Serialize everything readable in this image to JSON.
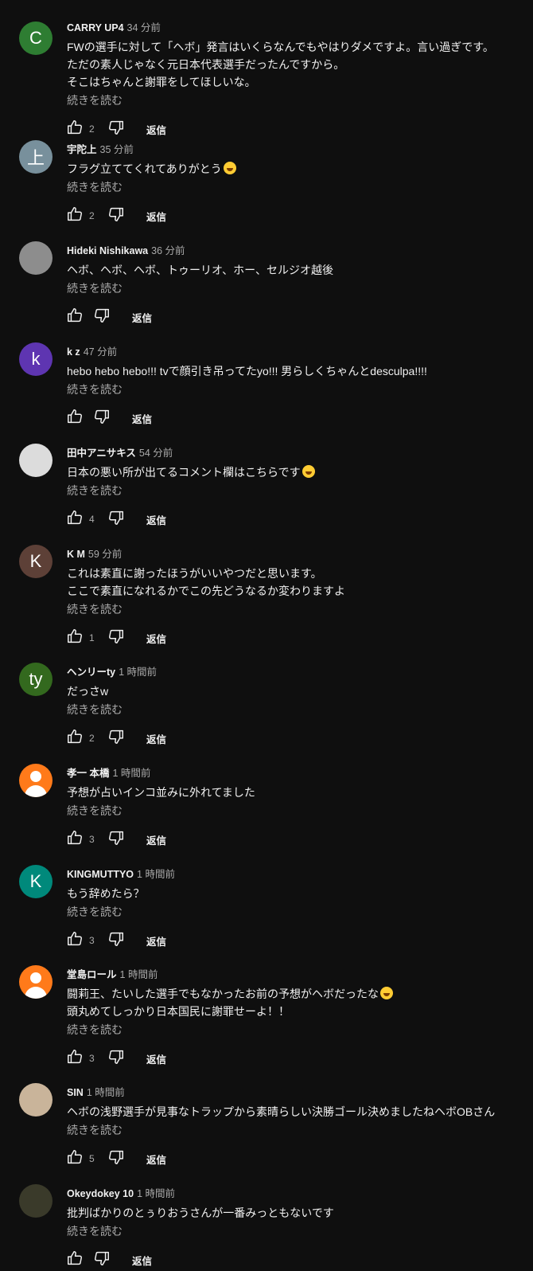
{
  "reply_label": "返信",
  "read_more_label": "続きを読む",
  "comments": [
    {
      "initial": "C",
      "avatar_color": "#2e7d32",
      "author": "CARRY UP4",
      "time": "34 分前",
      "lines": [
        "FWの選手に対して「ヘボ」発言はいくらなんでもやはりダメですよ。言い過ぎです。",
        "ただの素人じゃなく元日本代表選手だったんですから。",
        "そこはちゃんと謝罪をしてほしいな。"
      ],
      "likes": "2"
    },
    {
      "initial": "上",
      "avatar_color": "#78909c",
      "author": "宇陀上",
      "time": "35 分前",
      "lines": [
        "フラグ立ててくれてありがとう"
      ],
      "emoji_line": 0,
      "likes": "2"
    },
    {
      "initial": "",
      "avatar_color": "#8d8d8d",
      "author": "Hideki Nishikawa",
      "time": "36 分前",
      "lines": [
        "ヘボ、ヘボ、ヘボ、トゥーリオ、ホー、セルジオ越後"
      ],
      "likes": ""
    },
    {
      "initial": "k",
      "avatar_color": "#5e35b1",
      "author": "k z",
      "time": "47 分前",
      "lines": [
        "hebo hebo hebo!!! tvで顔引き吊ってたyo!!! 男らしくちゃんとdesculpa!!!!"
      ],
      "likes": ""
    },
    {
      "initial": "",
      "avatar_color": "#dcdcdc",
      "author": "田中アニサキス",
      "time": "54 分前",
      "lines": [
        "日本の悪い所が出てるコメント欄はこちらです"
      ],
      "emoji_line": 0,
      "likes": "4"
    },
    {
      "initial": "K",
      "avatar_color": "#5d4037",
      "author": "K M",
      "time": "59 分前",
      "lines": [
        "これは素直に謝ったほうがいいやつだと思います。",
        "ここで素直になれるかでこの先どうなるか変わりますよ"
      ],
      "likes": "1"
    },
    {
      "initial": "ty",
      "avatar_color": "#33691e",
      "author": "ヘンリーty",
      "time": "1 時間前",
      "lines": [
        "だっさw"
      ],
      "likes": "2"
    },
    {
      "initial": "",
      "avatar_color": "#ff7a1a",
      "person": true,
      "author": "孝一 本橋",
      "time": "1 時間前",
      "lines": [
        "予想が占いインコ並みに外れてました"
      ],
      "likes": "3"
    },
    {
      "initial": "K",
      "avatar_color": "#00897b",
      "author": "KINGMUTTYO",
      "time": "1 時間前",
      "lines": [
        "もう辞めたら？"
      ],
      "likes": "3"
    },
    {
      "initial": "",
      "avatar_color": "#ff7a1a",
      "person": true,
      "author": "堂島ロール",
      "time": "1 時間前",
      "lines": [
        "闘莉王、たいした選手でもなかったお前の予想がヘボだったな",
        "頭丸めてしっかり日本国民に謝罪せーよ！！"
      ],
      "emoji_line": 0,
      "likes": "3"
    },
    {
      "initial": "",
      "avatar_color": "#c9b49a",
      "author": "SIN",
      "time": "1 時間前",
      "lines": [
        "ヘボの浅野選手が見事なトラップから素晴らしい決勝ゴール決めましたねヘボOBさん"
      ],
      "likes": "5"
    },
    {
      "initial": "",
      "avatar_color": "#3a3a2a",
      "author": "Okeydokey 10",
      "time": "1 時間前",
      "lines": [
        "批判ばかりのとぅりおうさんが一番みっともないです"
      ],
      "likes": ""
    }
  ]
}
